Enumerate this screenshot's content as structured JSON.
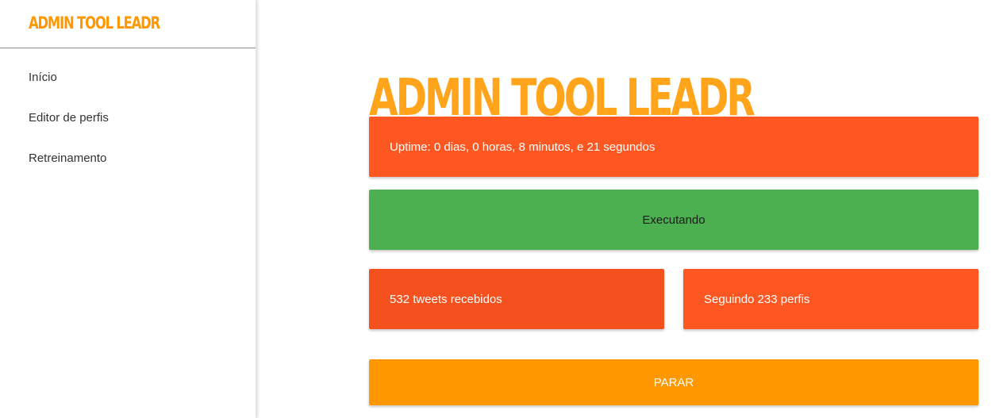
{
  "sidebar": {
    "brand": "ADMIN TOOL LEADR",
    "items": [
      {
        "label": "Início"
      },
      {
        "label": "Editor de perfis"
      },
      {
        "label": "Retreinamento"
      }
    ]
  },
  "main": {
    "title": "ADMIN TOOL LEADR",
    "uptime_text": "Uptime: 0 dias, 0 horas, 8 minutos, e 21 segundos",
    "status_text": "Executando",
    "tweets_text": "532 tweets recebidos",
    "following_text": "Seguindo 233 perfis",
    "stop_button_label": "PARAR"
  },
  "colors": {
    "accent_orange": "#ff9800",
    "title_orange": "#ffa41b",
    "card_red_orange": "#ff5722",
    "status_green": "#4caf50"
  }
}
